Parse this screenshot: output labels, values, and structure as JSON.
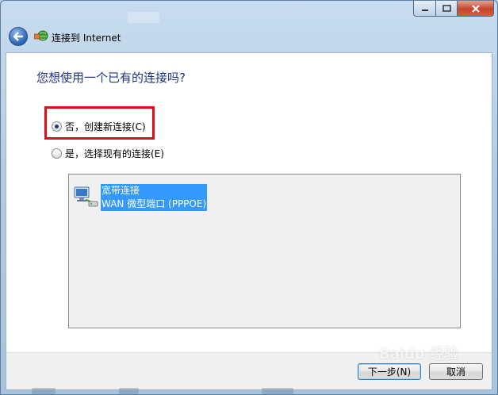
{
  "window": {
    "title": "连接到 Internet"
  },
  "page": {
    "question": "您想使用一个已有的连接吗?"
  },
  "options": [
    {
      "label": "否，创建新连接(C)",
      "selected": true
    },
    {
      "label": "是，选择现有的连接(E)",
      "selected": false
    }
  ],
  "connection": {
    "name": "宽带连接",
    "device": "WAN 微型端口 (PPPOE)",
    "icon": "network-connection-icon"
  },
  "buttons": {
    "next": "下一步(N)",
    "cancel": "取消"
  },
  "watermark": "Baidu 经验",
  "colors": {
    "question_text": "#1e3287",
    "highlight_box": "#d9111a",
    "selection": "#3399ff"
  }
}
